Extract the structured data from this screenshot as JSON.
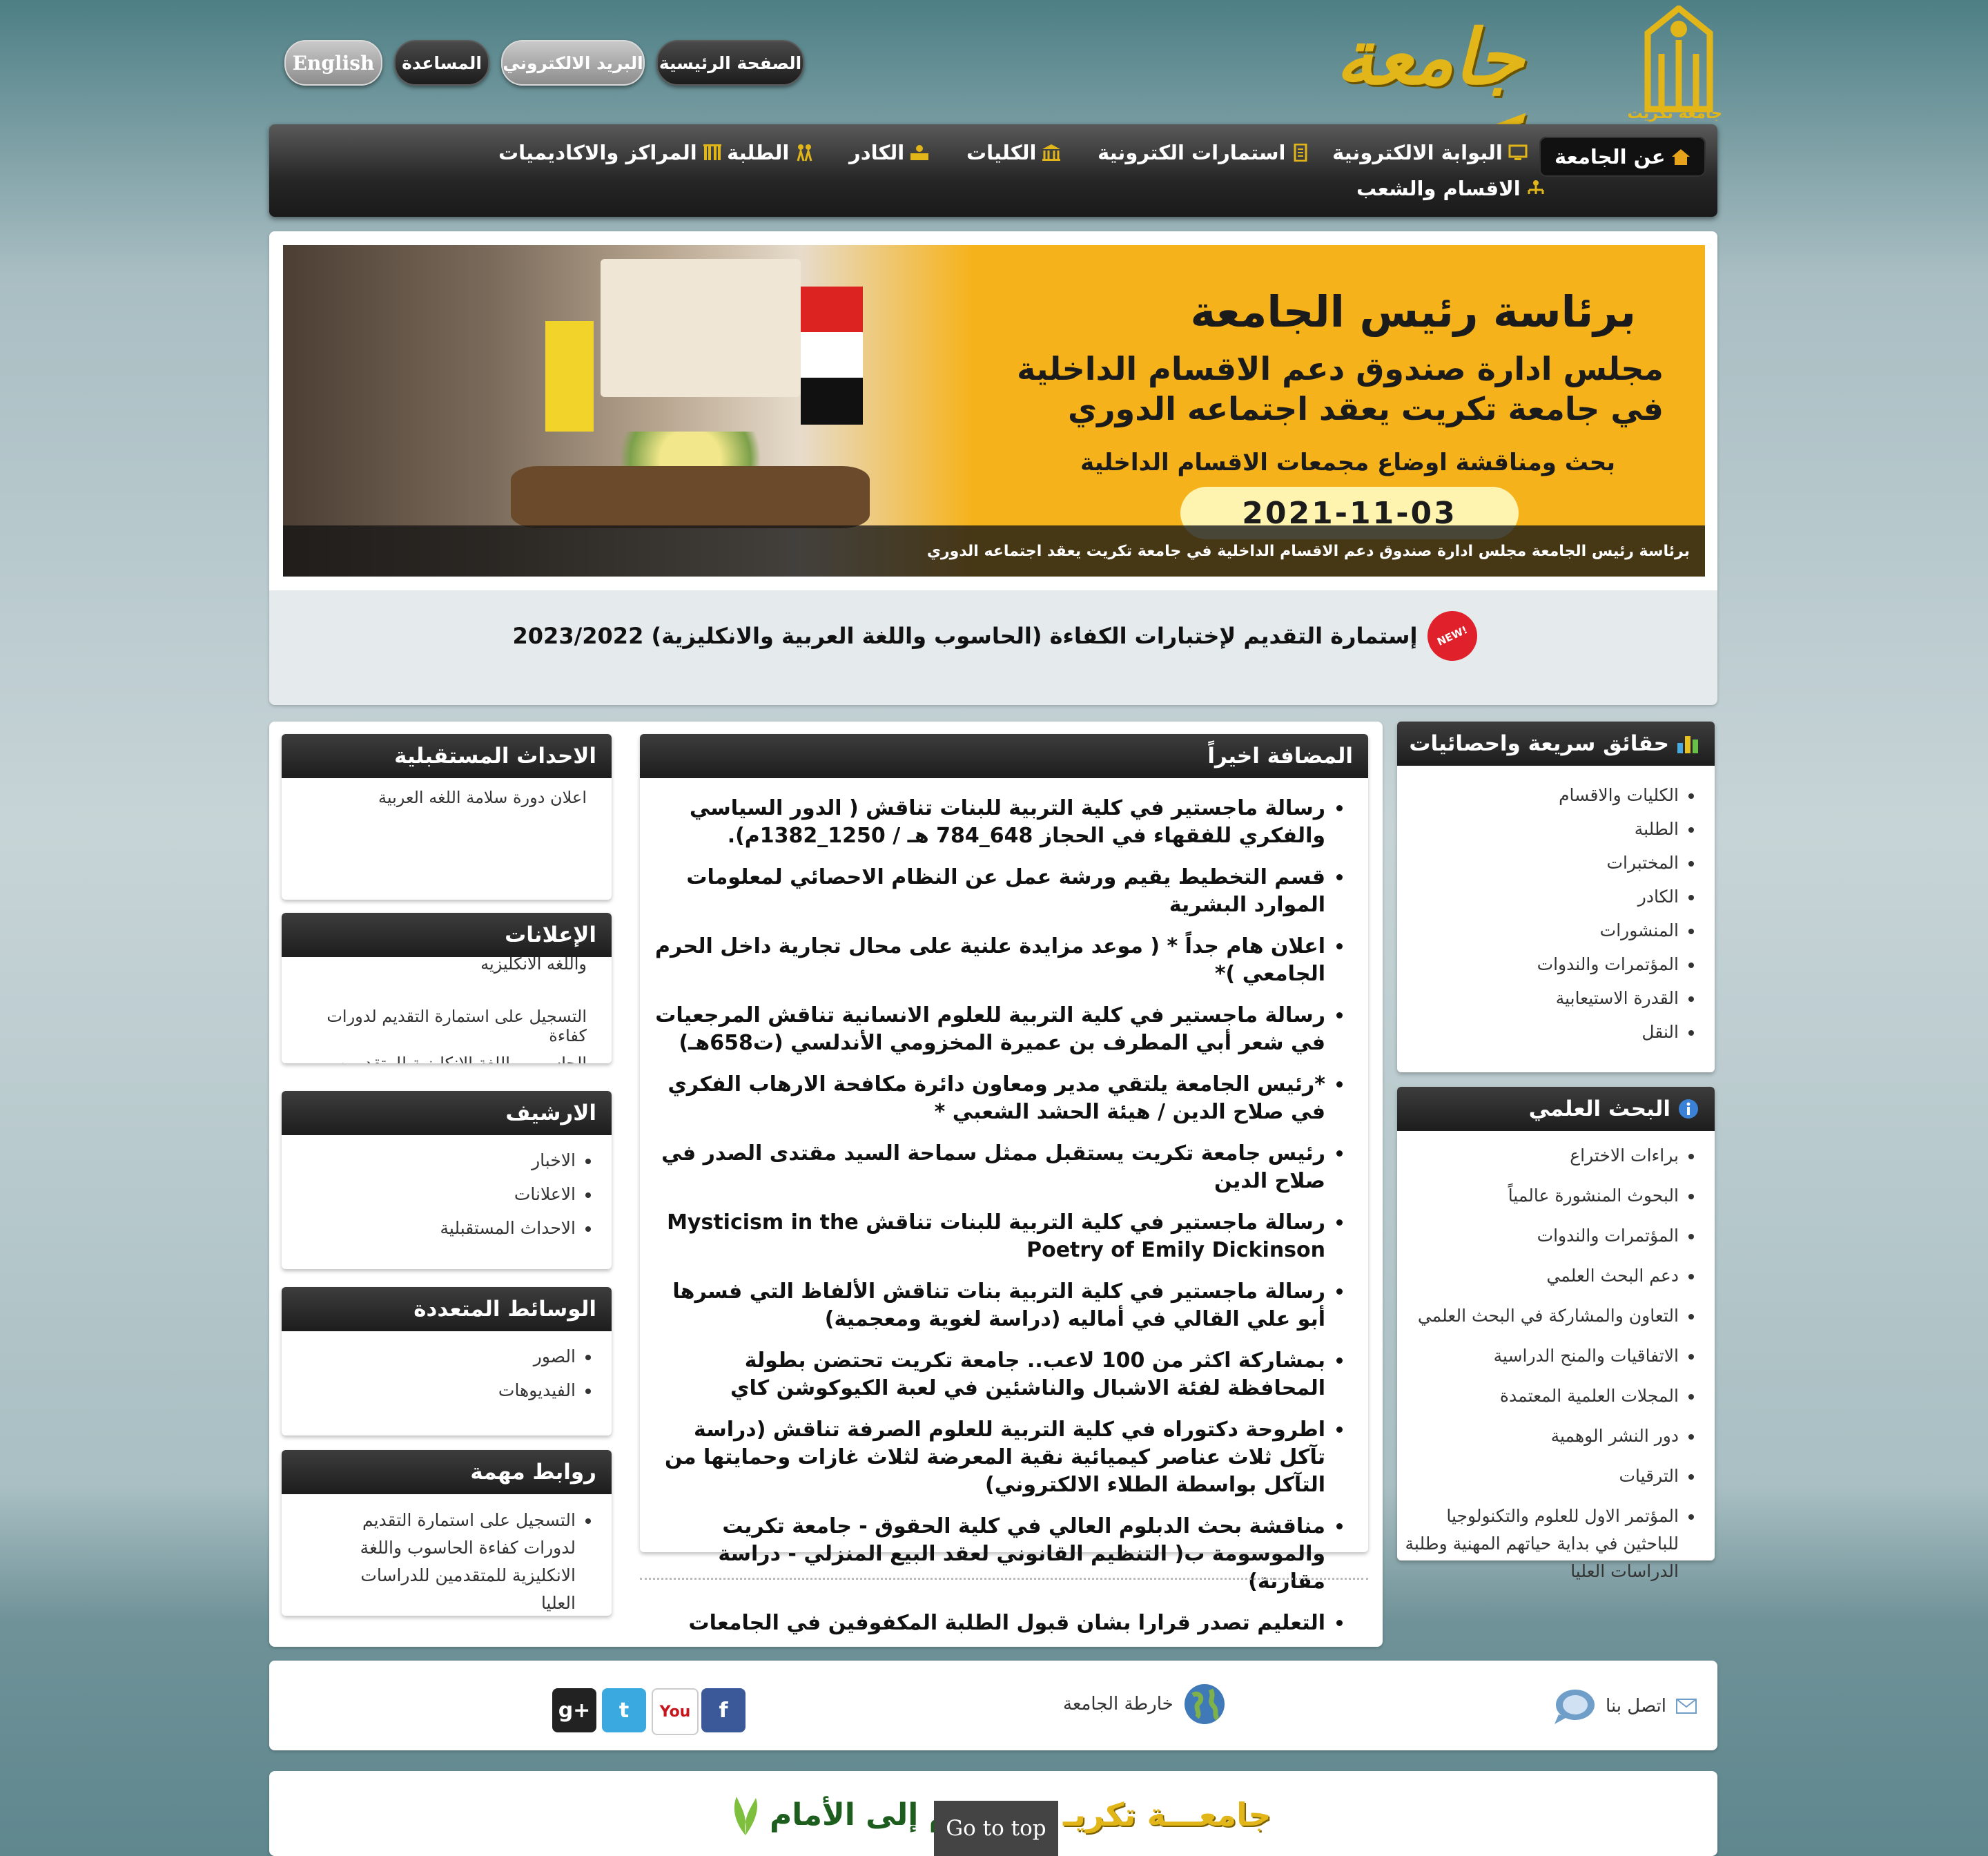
{
  "header": {
    "logo_text": "جامعة تكريت",
    "logo_small": "جامعة تكريت",
    "buttons": [
      "الصفحة الرئيسية",
      "البريد الالكتروني",
      "المساعدة",
      "English"
    ]
  },
  "nav": {
    "items": [
      "عن الجامعة",
      "البوابة الالكترونية",
      "استمارات الكترونية",
      "الكليات",
      "الكادر",
      "الطلبة",
      "المراكز والاكاديميات",
      "الاقسام والشعب"
    ]
  },
  "banner": {
    "line1": "برئاسة رئيس الجامعة",
    "line2": "مجلس ادارة صندوق دعم الاقسام الداخلية",
    "line3": "في جامعة تكريت يعقد اجتماعه الدوري",
    "line4": "بحث ومناقشة اوضاع مجمعات الاقسام الداخلية",
    "date": "2021-11-03",
    "caption": "برئاسة رئيس الجامعة مجلس ادارة صندوق دعم الاقسام الداخلية في جامعة تكريت يعقد اجتماعه الدوري"
  },
  "promo": {
    "text": "إستمارة التقديم لإختبارات الكفاءة (الحاسوب واللغة العربية والانكليزية) 2023/2022",
    "badge": "NEW!"
  },
  "facts": {
    "title": "حقائق سريعة واحصائيات",
    "items": [
      "الكليات والاقسام",
      "الطلبة",
      "المختبرات",
      "الكادر",
      "المنشورات",
      "المؤتمرات والندوات",
      "القدرة الاستيعابية",
      "النقل"
    ]
  },
  "research": {
    "title": "البحث العلمي",
    "items": [
      "براءات الاختراع",
      "البحوث المنشورة عالمياً",
      "المؤتمرات والندوات",
      "دعم البحث العلمي",
      "التعاون والمشاركة في البحث العلمي",
      "الاتفاقيات والمنح الدراسية",
      "المجلات العلمية المعتمدة",
      "دور النشر الوهمية",
      "الترقيات",
      "المؤتمر الاول للعلوم والتكنولوجيا للباحثين في بداية حياتهم المهنية وطلبة الدراسات العليا"
    ]
  },
  "latest": {
    "title": "المضافة اخيراً",
    "items": [
      "رسالة ماجستير في كلية التربية للبنات تناقش ( الدور السياسي والفكري للفقهاء في الحجاز 648_784 هـ / 1250_1382م).",
      "قسم التخطيط يقيم ورشة عمل عن النظام الاحصائي لمعلومات الموارد البشرية",
      "اعلان هام جداً * ( موعد مزايدة علنية على محال تجارية داخل الحرم الجامعي )*",
      "رسالة ماجستير في كلية التربية للعلوم الانسانية تناقش المرجعيات في شعر أبي المطرف بن عميرة المخزومي الأندلسي (ت658هـ)",
      "*رئيس الجامعة يلتقي مدير ومعاون دائرة مكافحة الارهاب الفكري في صلاح الدين / هيئة الحشد الشعبي *",
      "رئيس جامعة تكريت يستقبل ممثل سماحة السيد مقتدى الصدر في صلاح الدين",
      "رسالة ماجستير في كلية التربية للبنات تناقش Mysticism in the Poetry of Emily Dickinson",
      "رسالة ماجستير في كلية التربية بنات تناقش الألفاظ التي فسرها أبو علي القالي في أماليه (دراسة لغوية ومعجمية)",
      "بمشاركة اكثر من 100 لاعب.. جامعة تكريت تحتضن بطولة المحافظة لفئة الاشبال والناشئين في لعبة الكيوكوشن كاي",
      "اطروحة دكتوراه في كلية التربية للعلوم الصرفة تناقش (دراسة تآكل ثلاث عناصر كيميائية نقية المعرضة لثلاث غازات وحمايتها من التآكل بواسطة الطلاء الالكتروني)",
      "مناقشة بحث الدبلوم العالي في كلية الحقوق - جامعة تكريت والموسومة ب( التنظيم القانوني لعقد البيع المنزلي - دراسة مقارنة)",
      "التعليم تصدر قرارا بشان قبول الطلبة المكفوفين في الجامعات"
    ]
  },
  "events": {
    "title": "الاحداث المستقبلية",
    "text": "اعلان دورة سلامة اللغه العربية"
  },
  "ads": {
    "title": "الإعلانات",
    "text1": "واللغه الانكليزيه",
    "text2": "التسجيل على استمارة التقديم لدورات كفاءة",
    "text3": "الحاسوب واللغة الانكليزية للمتقدمين"
  },
  "archive": {
    "title": "الارشيف",
    "items": [
      "الاخبار",
      "الاعلانات",
      "الاحداث المستقبلية"
    ]
  },
  "media": {
    "title": "الوسائط المتعددة",
    "items": [
      "الصور",
      "الفيديوهات"
    ]
  },
  "links": {
    "title": "روابط مهمة",
    "items": [
      "التسجيل على استمارة التقديم لدورات كفاءة الحاسوب واللغة الانكليزية للمتقدمين للدراسات العليا"
    ]
  },
  "footer": {
    "contact": "اتصل بنا",
    "map": "خارطة الجامعة",
    "social": [
      "facebook-icon",
      "youtube-icon",
      "twitter-icon",
      "google-plus-icon"
    ],
    "slogan_left": "جامعـــة تكريـ",
    "slogan_right": "م إلى الأمام",
    "go_top": "Go to top"
  }
}
